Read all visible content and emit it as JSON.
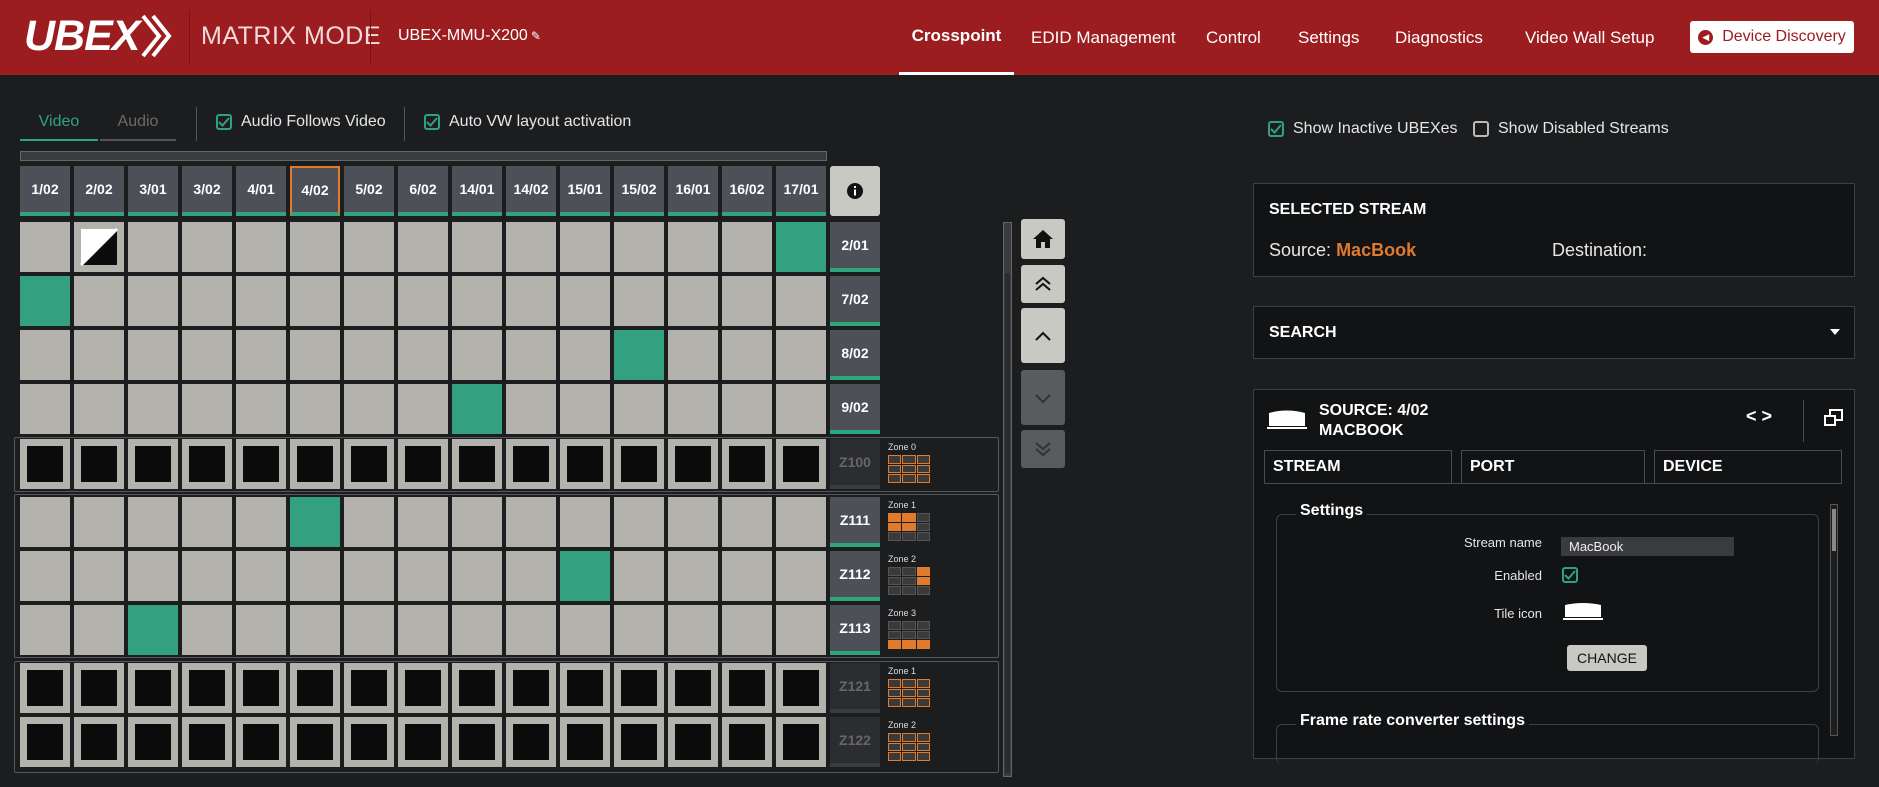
{
  "header": {
    "logo": "UBEX",
    "mode": "MATRIX MODE",
    "device_name": "UBEX-MMU-X200",
    "nav": [
      "Crosspoint",
      "EDID Management",
      "Control",
      "Settings",
      "Diagnostics",
      "Video Wall Setup"
    ],
    "active_nav": "Crosspoint",
    "device_discovery": "Device Discovery"
  },
  "toolbar": {
    "tab_video": "Video",
    "tab_audio": "Audio",
    "audio_follows_video": "Audio Follows Video",
    "auto_vw": "Auto VW layout activation"
  },
  "matrix": {
    "columns": [
      "1/02",
      "2/02",
      "3/01",
      "3/02",
      "4/01",
      "4/02",
      "5/02",
      "6/02",
      "14/01",
      "14/02",
      "15/01",
      "15/02",
      "16/01",
      "16/02",
      "17/01"
    ],
    "selected_column": "4/02",
    "rows": [
      "2/01",
      "7/02",
      "8/02",
      "9/02",
      "Z100",
      "Z111",
      "Z112",
      "Z113",
      "Z121",
      "Z122"
    ],
    "zones": {
      "Z100": "Zone 0",
      "Z111": "Zone 1",
      "Z112": "Zone 2",
      "Z113": "Zone 3",
      "Z121": "Zone 1",
      "Z122": "Zone 2"
    },
    "connections": [
      [
        "2/01",
        "17/01"
      ],
      [
        "7/02",
        "1/02"
      ],
      [
        "8/02",
        "15/02"
      ],
      [
        "9/02",
        "14/01"
      ],
      [
        "Z111",
        "4/02"
      ],
      [
        "Z112",
        "15/01"
      ],
      [
        "Z113",
        "3/01"
      ]
    ],
    "disabled_cell": [
      "2/01",
      "2/02"
    ]
  },
  "right": {
    "show_inactive": "Show Inactive UBEXes",
    "show_disabled": "Show Disabled Streams",
    "selected_stream_title": "SELECTED STREAM",
    "source_label": "Source:",
    "source_value": "MacBook",
    "destination_label": "Destination:",
    "search_title": "SEARCH",
    "source_title": "SOURCE: 4/02",
    "source_subtitle": "MACBOOK",
    "tabs": [
      "STREAM",
      "PORT",
      "DEVICE"
    ],
    "settings_legend": "Settings",
    "stream_name_label": "Stream name",
    "stream_name_value": "MacBook",
    "enabled_label": "Enabled",
    "tile_icon_label": "Tile icon",
    "change_button": "CHANGE",
    "frc_legend": "Frame rate converter settings"
  },
  "colors": {
    "brand": "#9b1d20",
    "accent": "#2fa57e",
    "highlight": "#e07a2c"
  }
}
